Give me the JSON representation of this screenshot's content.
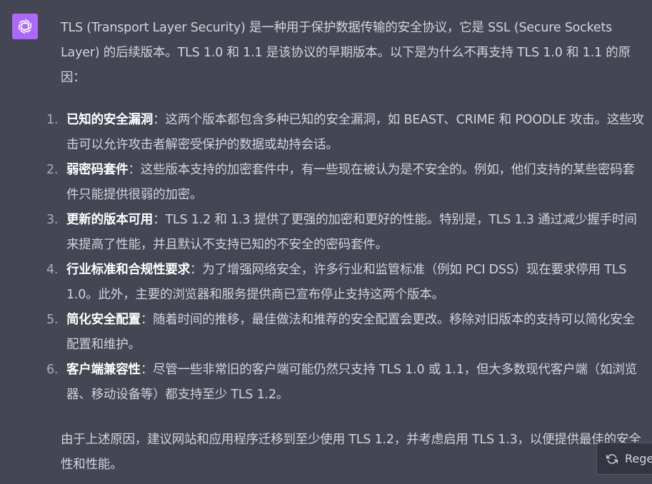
{
  "assistant": {
    "avatar_icon": "openai-logo-icon",
    "avatar_color": "#ab68ff"
  },
  "message": {
    "intro": "TLS (Transport Layer Security) 是一种用于保护数据传输的安全协议，它是 SSL (Secure Sockets Layer) 的后续版本。TLS 1.0 和 1.1 是该协议的早期版本。以下是为什么不再支持 TLS 1.0 和 1.1 的原因：",
    "points": [
      {
        "num": "1.",
        "title": "已知的安全漏洞",
        "text": "：这两个版本都包含多种已知的安全漏洞，如 BEAST、CRIME 和 POODLE 攻击。这些攻击可以允许攻击者解密受保护的数据或劫持会话。"
      },
      {
        "num": "2.",
        "title": "弱密码套件",
        "text": "：这些版本支持的加密套件中，有一些现在被认为是不安全的。例如，他们支持的某些密码套件只能提供很弱的加密。"
      },
      {
        "num": "3.",
        "title": "更新的版本可用",
        "text": "：TLS 1.2 和 1.3 提供了更强的加密和更好的性能。特别是，TLS 1.3 通过减少握手时间来提高了性能，并且默认不支持已知的不安全的密码套件。"
      },
      {
        "num": "4.",
        "title": "行业标准和合规性要求",
        "text": "：为了增强网络安全，许多行业和监管标准（例如 PCI DSS）现在要求停用 TLS 1.0。此外，主要的浏览器和服务提供商已宣布停止支持这两个版本。"
      },
      {
        "num": "5.",
        "title": "简化安全配置",
        "text": "：随着时间的推移，最佳做法和推荐的安全配置会更改。移除对旧版本的支持可以简化安全配置和维护。"
      },
      {
        "num": "6.",
        "title": "客户端兼容性",
        "text": "：尽管一些非常旧的客户端可能仍然只支持 TLS 1.0 或 1.1，但大多数现代客户端（如浏览器、移动设备等）都支持至少 TLS 1.2。"
      }
    ],
    "conclusion": "由于上述原因，建议网站和应用程序迁移到至少使用 TLS 1.2，并考虑启用 TLS 1.3，以便提供最佳的安全性和性能。"
  },
  "regenerate": {
    "label": "Regenerate response",
    "icon": "refresh-icon"
  }
}
